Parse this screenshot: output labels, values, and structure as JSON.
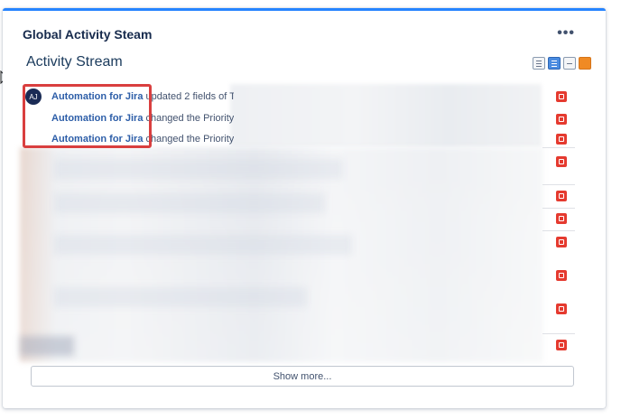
{
  "gadget": {
    "title": "Global Activity Steam",
    "menu_label": "•••"
  },
  "stream": {
    "title": "Activity Stream",
    "view_icons": [
      "list-view-icon",
      "detailed-view-icon",
      "filter-icon",
      "rss-icon"
    ]
  },
  "items": [
    {
      "avatar": "AJ",
      "author": "Automation for Jira",
      "action": "updated 2 fields of T"
    },
    {
      "author": "Automation for Jira",
      "action": "changed the Priority"
    },
    {
      "author": "Automation for Jira",
      "action": "changed the Priority"
    }
  ],
  "footer": {
    "show_more_label": "Show more..."
  },
  "colors": {
    "accent": "#2684ff",
    "author_link": "#2d5ea8",
    "edit_icon": "#e53a2f",
    "highlight": "#d93f3f"
  }
}
